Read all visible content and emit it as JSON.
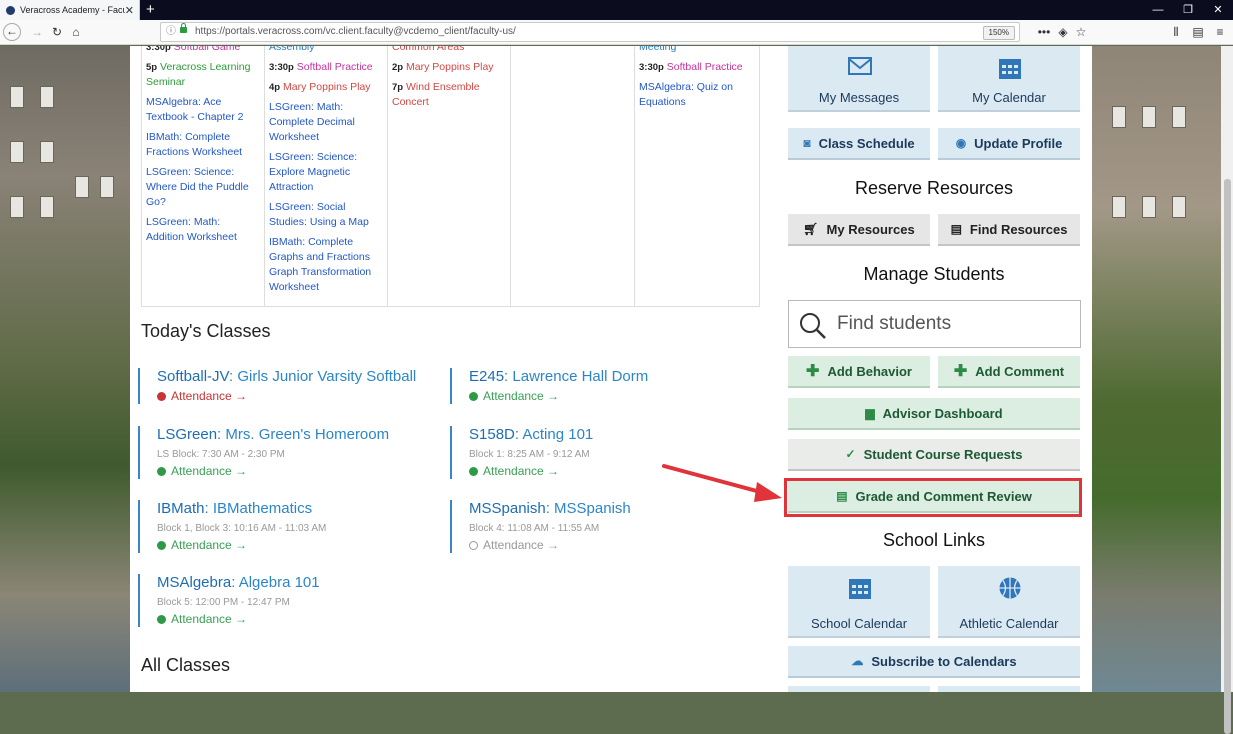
{
  "browser": {
    "tab_title": "Veracross Academy - Faculty U...",
    "url": "https://portals.veracross.com/vc.client.faculty@vcdemo_client/faculty-us/",
    "zoom": "150%"
  },
  "calendar": {
    "columns": [
      [
        {
          "time": "3:30p",
          "title": "Softball Game",
          "color": "pink"
        },
        {
          "time": "5p",
          "title": "Veracross Learning Seminar",
          "color": "green"
        },
        {
          "time": "",
          "title": "MSAlgebra: Ace Textbook - Chapter 2",
          "color": "blue"
        },
        {
          "time": "",
          "title": "IBMath: Complete Fractions Worksheet",
          "color": "blue"
        },
        {
          "time": "",
          "title": "LSGreen: Science: Where Did the Puddle Go?",
          "color": "blue"
        },
        {
          "time": "",
          "title": "LSGreen: Math: Addition Worksheet",
          "color": "blue"
        }
      ],
      [
        {
          "time": "",
          "title": "Assembly",
          "color": "teal"
        },
        {
          "time": "3:30p",
          "title": "Softball Practice",
          "color": "pink"
        },
        {
          "time": "4p",
          "title": "Mary Poppins Play",
          "color": "red"
        },
        {
          "time": "",
          "title": "LSGreen: Math: Complete Decimal Worksheet",
          "color": "blue"
        },
        {
          "time": "",
          "title": "LSGreen: Science: Explore Magnetic Attraction",
          "color": "blue"
        },
        {
          "time": "",
          "title": "LSGreen: Social Studies: Using a Map",
          "color": "blue"
        },
        {
          "time": "",
          "title": "IBMath: Complete Graphs and Fractions Graph Transformation Worksheet",
          "color": "blue"
        }
      ],
      [
        {
          "time": "",
          "title": "Common Areas",
          "color": "red"
        },
        {
          "time": "2p",
          "title": "Mary Poppins Play",
          "color": "red"
        },
        {
          "time": "7p",
          "title": "Wind Ensemble Concert",
          "color": "red"
        }
      ],
      [],
      [
        {
          "time": "",
          "title": "Meeting",
          "color": "teal"
        },
        {
          "time": "3:30p",
          "title": "Softball Practice",
          "color": "pink"
        },
        {
          "time": "",
          "title": "MSAlgebra: Quiz on Equations",
          "color": "blue"
        }
      ]
    ]
  },
  "todays_classes": {
    "title": "Today's Classes",
    "items": [
      {
        "code": "Softball-JV",
        "name": ": Girls Junior Varsity Softball",
        "meta": "",
        "attendance": "Attendance →",
        "status": "absent"
      },
      {
        "code": "E245",
        "name": ": Lawrence Hall Dorm",
        "meta": "",
        "attendance": "Attendance →",
        "status": "done"
      },
      {
        "code": "LSGreen",
        "name": ": Mrs. Green's Homeroom",
        "meta": "LS Block: 7:30 AM - 2:30 PM",
        "attendance": "Attendance →",
        "status": "done"
      },
      {
        "code": "S158D",
        "name": ": Acting 101",
        "meta": "Block 1: 8:25 AM - 9:12 AM",
        "attendance": "Attendance →",
        "status": "done"
      },
      {
        "code": "IBMath",
        "name": ": IBMathematics",
        "meta": "Block 1, Block 3: 10:16 AM - 11:03 AM",
        "attendance": "Attendance →",
        "status": "done"
      },
      {
        "code": "MSSpanish",
        "name": ": MSSpanish",
        "meta": "Block 4: 11:08 AM - 11:55 AM",
        "attendance": "Attendance →",
        "status": "empty"
      },
      {
        "code": "MSAlgebra",
        "name": ": Algebra 101",
        "meta": "Block 5: 12:00 PM - 12:47 PM",
        "attendance": "Attendance →",
        "status": "done"
      }
    ]
  },
  "all_classes_title": "All Classes",
  "panel": {
    "my_messages": "My Messages",
    "my_calendar": "My Calendar",
    "class_schedule": "Class Schedule",
    "update_profile": "Update Profile",
    "reserve_title": "Reserve Resources",
    "my_resources": "My Resources",
    "find_resources": "Find Resources",
    "manage_title": "Manage Students",
    "search_placeholder": "Find students",
    "add_behavior": "Add Behavior",
    "add_comment": "Add Comment",
    "advisor_dashboard": "Advisor Dashboard",
    "student_course_requests": "Student Course Requests",
    "grade_comment_review": "Grade and Comment Review",
    "school_links_title": "School Links",
    "school_calendar": "School Calendar",
    "athletic_calendar": "Athletic Calendar",
    "subscribe": "Subscribe to Calendars"
  },
  "colors": {
    "highlight": "#e0343a",
    "link_blue": "#2b86c9",
    "attendance_green": "#39a055"
  }
}
